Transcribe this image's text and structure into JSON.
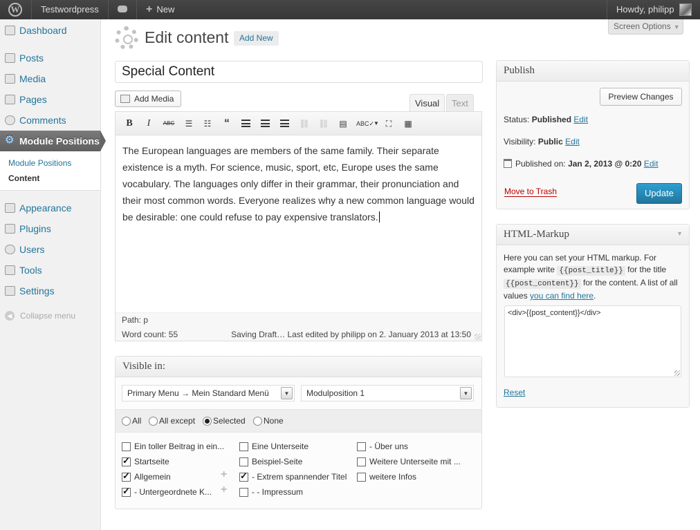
{
  "adminbar": {
    "site_name": "Testwordpress",
    "new_label": "New",
    "howdy": "Howdy, philipp"
  },
  "sidebar": {
    "items": [
      {
        "label": "Dashboard"
      },
      {
        "label": "Posts"
      },
      {
        "label": "Media"
      },
      {
        "label": "Pages"
      },
      {
        "label": "Comments"
      },
      {
        "label": "Module Positions"
      },
      {
        "label": "Appearance"
      },
      {
        "label": "Plugins"
      },
      {
        "label": "Users"
      },
      {
        "label": "Tools"
      },
      {
        "label": "Settings"
      }
    ],
    "submenu": [
      "Module Positions",
      "Content"
    ],
    "collapse": "Collapse menu"
  },
  "screen_options": "Screen Options",
  "page": {
    "title": "Edit content",
    "add_new": "Add New"
  },
  "post": {
    "title": "Special Content"
  },
  "editor": {
    "add_media": "Add Media",
    "tab_visual": "Visual",
    "tab_text": "Text",
    "content": "The European languages are members of the same family. Their separate existence is a myth. For science, music, sport, etc, Europe uses the same vocabulary. The languages only differ in their grammar, their pronunciation and their most common words. Everyone realizes why a new common language would be desirable: one could refuse to pay expensive translators.",
    "path": "Path: p",
    "word_count": "Word count: 55",
    "last_edited": "Saving Draft… Last edited by philipp on 2. January 2013 at 13:50"
  },
  "visible_in": {
    "title": "Visible in:",
    "menu_select": "Primary Menu → Mein Standard Menü",
    "position_select": "Modulposition 1",
    "radios": [
      {
        "label": "All",
        "checked": false
      },
      {
        "label": "All except",
        "checked": false
      },
      {
        "label": "Selected",
        "checked": true
      },
      {
        "label": "None",
        "checked": false
      }
    ],
    "pages": [
      {
        "label": "Ein toller Beitrag in ein...",
        "checked": false
      },
      {
        "label": "Startseite",
        "checked": true
      },
      {
        "label": "Allgemein",
        "checked": true
      },
      {
        "label": "- Untergeordnete K...",
        "checked": true
      },
      {
        "label": "Eine Unterseite",
        "checked": false
      },
      {
        "label": "Beispiel-Seite",
        "checked": false
      },
      {
        "label": "- Extrem spannender Titel",
        "checked": true
      },
      {
        "label": "- - Impressum",
        "checked": false
      },
      {
        "label": "- Über uns",
        "checked": false
      },
      {
        "label": "Weitere Unterseite mit ...",
        "checked": false
      },
      {
        "label": "weitere Infos",
        "checked": false
      }
    ]
  },
  "publish": {
    "title": "Publish",
    "preview": "Preview Changes",
    "status_label": "Status:",
    "status_value": "Published",
    "visibility_label": "Visibility:",
    "visibility_value": "Public",
    "published_label": "Published on:",
    "published_value": "Jan 2, 2013 @ 0:20",
    "edit": "Edit",
    "trash": "Move to Trash",
    "update": "Update"
  },
  "markup": {
    "title": "HTML-Markup",
    "desc_1": "Here you can set your HTML markup. For example write",
    "code_1": "{{post_title}}",
    "desc_2": "for the title",
    "code_2": "{{post_content}}",
    "desc_3": "for the content. A list of all values",
    "link": "you can find here",
    "desc_4": ".",
    "template": "<div>{{post_content}}</div>",
    "reset": "Reset"
  }
}
